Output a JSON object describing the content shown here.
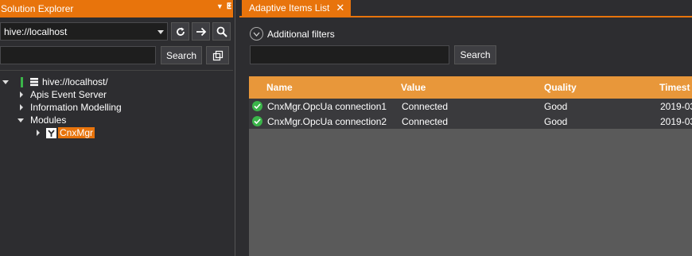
{
  "solution_explorer": {
    "title": "Solution Explorer",
    "pin_glyph": "▾ ⊥",
    "address_value": "hive://localhost",
    "search_button": "Search",
    "tree": [
      {
        "label": "hive://localhost/",
        "expanded": true,
        "icon": "server-icon"
      },
      {
        "label": "Apis Event Server",
        "expanded": false
      },
      {
        "label": "Information Modelling",
        "expanded": false
      },
      {
        "label": "Modules",
        "expanded": true
      },
      {
        "label": "CnxMgr",
        "expanded": false,
        "selected": true,
        "icon": "module-icon"
      }
    ]
  },
  "adaptive_items": {
    "tab_label": "Adaptive Items List",
    "tab_close": "✕",
    "filters_label": "Additional filters",
    "search_button": "Search",
    "columns": [
      "Name",
      "Value",
      "Quality",
      "Timest"
    ],
    "rows": [
      {
        "name": "CnxMgr.OpcUa connection1",
        "value": "Connected",
        "quality": "Good",
        "timestamp": "2019-03"
      },
      {
        "name": "CnxMgr.OpcUa connection2",
        "value": "Connected",
        "quality": "Good",
        "timestamp": "2019-03"
      }
    ]
  },
  "colors": {
    "accent": "#e8740c",
    "header": "#e8973a",
    "status_good": "#3bb54a"
  }
}
